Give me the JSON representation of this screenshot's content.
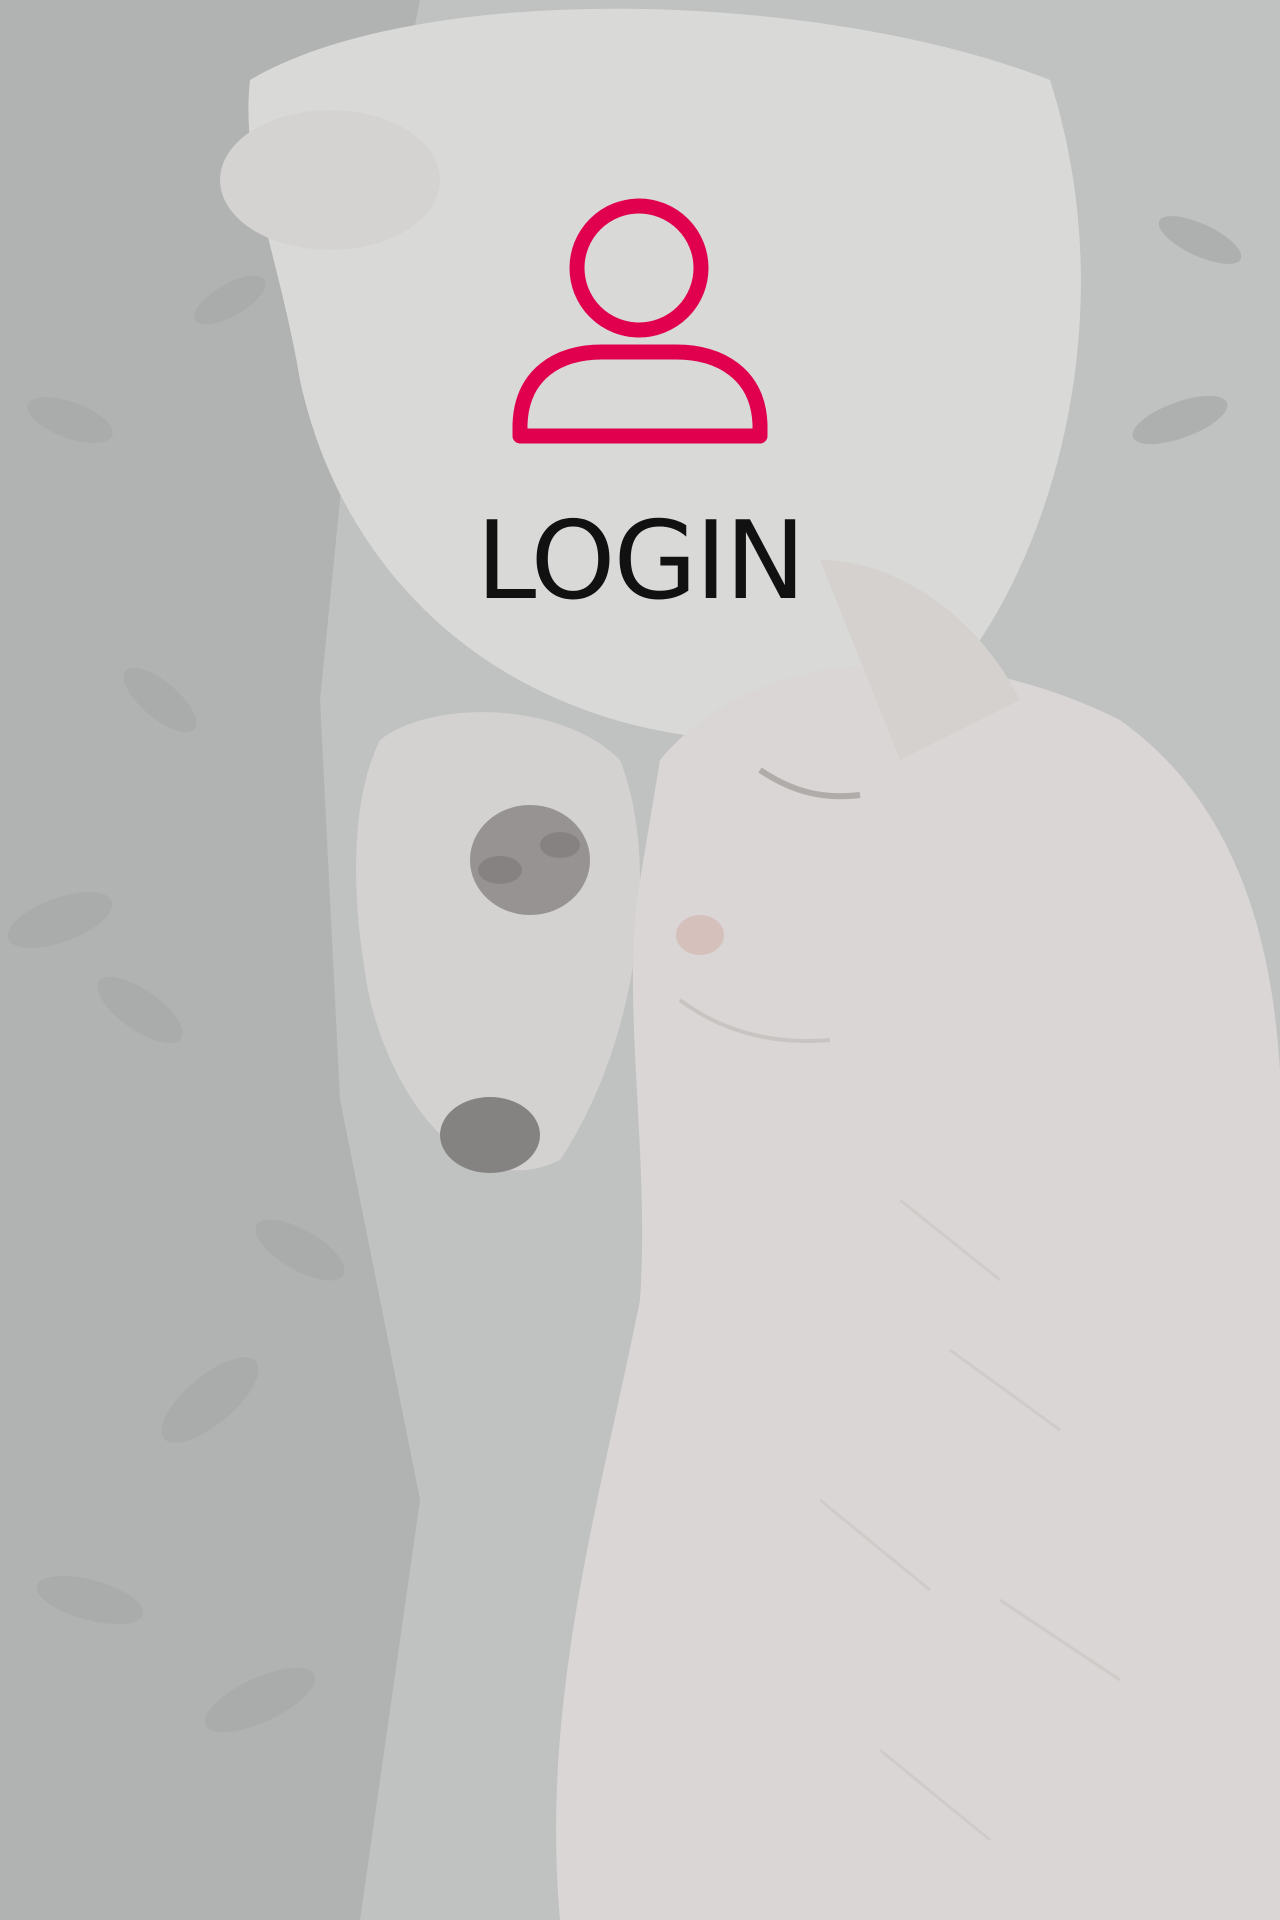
{
  "login": {
    "title": "LOGIN",
    "icon": "user-icon"
  },
  "colors": {
    "accent": "#e0004d",
    "text": "#111111",
    "background_tint": "#c9c9c9"
  },
  "background": {
    "image": "cat-and-dog-photo"
  }
}
